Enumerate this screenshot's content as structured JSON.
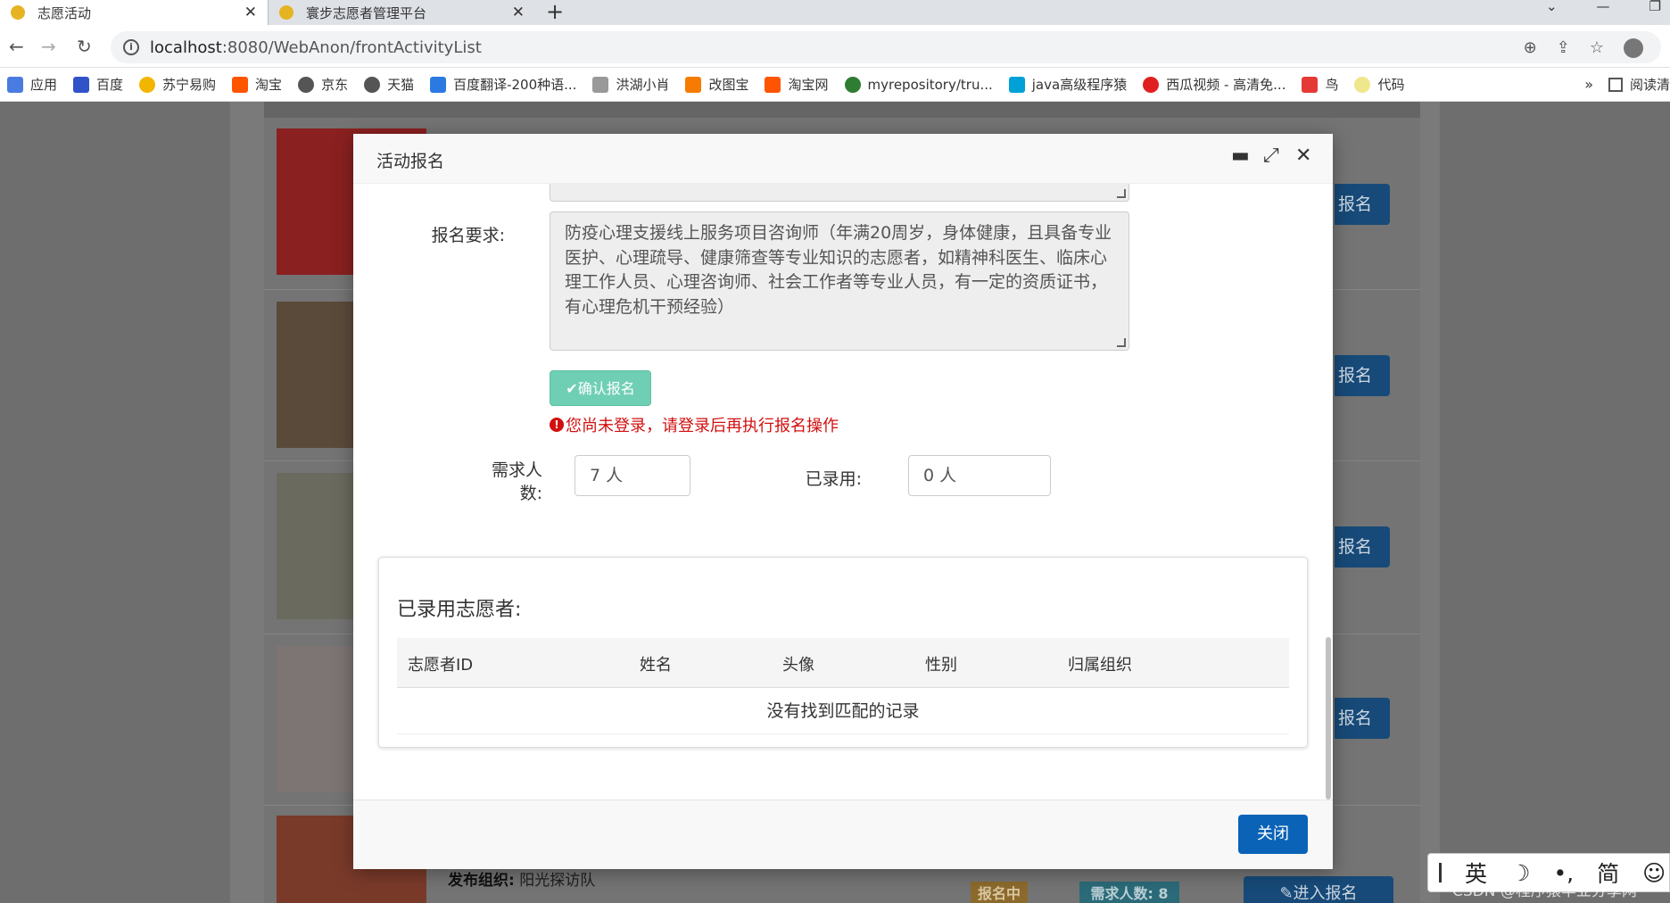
{
  "browser": {
    "tabs": [
      {
        "title": "志愿活动",
        "close": "✕"
      },
      {
        "title": "寰步志愿者管理平台",
        "close": "✕"
      }
    ],
    "new_tab": "+",
    "url_host": "localhost",
    "url_path": ":8080/WebAnon/frontActivityList",
    "bookmarks": [
      "应用",
      "百度",
      "苏宁易购",
      "淘宝",
      "京东",
      "天猫",
      "百度翻译-200种语...",
      "洪湖小肖",
      "改图宝",
      "淘宝网",
      "myrepository/tru...",
      "java高级程序猿",
      "西瓜视频 - 高清免...",
      "鸟",
      "代码"
    ],
    "bookmark_more": "»",
    "reading_list": "阅读清"
  },
  "background": {
    "row_button_label": "报名",
    "bottom_row": {
      "org_label": "发布组织:",
      "org_value": "阳光探访队",
      "status_badge": "报名中",
      "need_badge": "需求人数: 8",
      "enter_button": "进入报名"
    }
  },
  "modal": {
    "title": "活动报名",
    "requirement_label": "报名要求:",
    "requirement_text": "防疫心理支援线上服务项目咨询师（年满20周岁，身体健康，且具备专业医护、心理疏导、健康筛查等专业知识的志愿者，如精神科医生、临床心理工作人员、心理咨询师、社会工作者等专业人员，有一定的资质证书，有心理危机干预经验）",
    "confirm_button": "确认报名",
    "error_message": "您尚未登录，请登录后再执行报名操作",
    "need_label": "需求人数:",
    "need_value": "7 人",
    "hired_label": "已录用:",
    "hired_value": "0 人",
    "hired_panel_title": "已录用志愿者:",
    "columns": [
      "志愿者ID",
      "姓名",
      "头像",
      "性别",
      "归属组织"
    ],
    "empty_text": "没有找到匹配的记录",
    "close_button": "关闭"
  },
  "ime": {
    "items": [
      "英",
      "简"
    ]
  },
  "watermark": "CSDN @程序猿毕业分享网",
  "colors": {
    "primary": "#0a63b6",
    "confirm": "#6fcfb4",
    "error": "#d20f0f"
  }
}
